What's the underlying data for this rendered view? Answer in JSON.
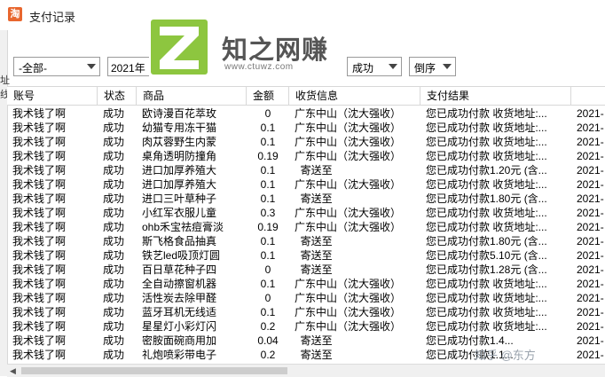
{
  "window": {
    "title": "支付记录",
    "app_icon_label": "淘"
  },
  "left_edge_glyphs": [
    "址",
    "线"
  ],
  "toolbar": {
    "scope_filter": "-全部-",
    "date_value": "2021年",
    "status_filter": "成功",
    "sort_order": "倒序"
  },
  "columns": [
    "账号",
    "状态",
    "商品",
    "金额",
    "收货信息",
    "支付结果"
  ],
  "rows": [
    {
      "account": "我术钱了啊",
      "status": "成功",
      "product": "欧诗漫百花萃玫",
      "amount": "0",
      "address": "广东中山（沈大强收）",
      "result": "您已成功付款 收货地址:...",
      "date": "2021-"
    },
    {
      "account": "我术钱了啊",
      "status": "成功",
      "product": "幼猫专用冻干猫",
      "amount": "0.1",
      "address": "广东中山（沈大强收）",
      "result": "您已成功付款 收货地址:...",
      "date": "2021-"
    },
    {
      "account": "我术钱了啊",
      "status": "成功",
      "product": "肉苁蓉野生内蒙",
      "amount": "0.1",
      "address": "广东中山（沈大强收）",
      "result": "您已成功付款 收货地址:...",
      "date": "2021-"
    },
    {
      "account": "我术钱了啊",
      "status": "成功",
      "product": "桌角透明防撞角",
      "amount": "0.19",
      "address": "广东中山（沈大强收）",
      "result": "您已成功付款 收货地址:...",
      "date": "2021-"
    },
    {
      "account": "我术钱了啊",
      "status": "成功",
      "product": "进口加厚养殖大",
      "amount": "0.1",
      "address": "  寄送至",
      "result": "您已成功付款1.20元 (含...",
      "date": "2021-"
    },
    {
      "account": "我术钱了啊",
      "status": "成功",
      "product": "进口加厚养殖大",
      "amount": "0.1",
      "address": "广东中山（沈大强收）",
      "result": "您已成功付款 收货地址:...",
      "date": "2021-"
    },
    {
      "account": "我术钱了啊",
      "status": "成功",
      "product": "进口三叶草种子",
      "amount": "0.1",
      "address": "  寄送至",
      "result": "您已成功付款1.80元 (含...",
      "date": "2021-"
    },
    {
      "account": "我术钱了啊",
      "status": "成功",
      "product": "小红军衣服儿童",
      "amount": "0.3",
      "address": "广东中山（沈大强收）",
      "result": "您已成功付款 收货地址:...",
      "date": "2021-"
    },
    {
      "account": "我术钱了啊",
      "status": "成功",
      "product": "ohb禾宝祛痘膏淡",
      "amount": "0.19",
      "address": "广东中山（沈大强收）",
      "result": "您已成功付款 收货地址:...",
      "date": "2021-"
    },
    {
      "account": "我术钱了啊",
      "status": "成功",
      "product": "斯飞格食品抽真",
      "amount": "0.1",
      "address": "  寄送至",
      "result": "您已成功付款1.80元 (含...",
      "date": "2021-"
    },
    {
      "account": "我术钱了啊",
      "status": "成功",
      "product": "铁艺led吸顶灯圆",
      "amount": "0.1",
      "address": "  寄送至",
      "result": "您已成功付款5.10元 (含...",
      "date": "2021-"
    },
    {
      "account": "我术钱了啊",
      "status": "成功",
      "product": "百日草花种子四",
      "amount": "0",
      "address": "  寄送至",
      "result": "您已成功付款1.28元 (含...",
      "date": "2021-"
    },
    {
      "account": "我术钱了啊",
      "status": "成功",
      "product": "全自动擦窗机器",
      "amount": "0.1",
      "address": "广东中山（沈大强收）",
      "result": "您已成功付款 收货地址:...",
      "date": "2021-"
    },
    {
      "account": "我术钱了啊",
      "status": "成功",
      "product": "活性炭去除甲醛",
      "amount": "0",
      "address": "广东中山（沈大强收）",
      "result": "您已成功付款 收货地址:...",
      "date": "2021-"
    },
    {
      "account": "我术钱了啊",
      "status": "成功",
      "product": "蓝牙耳机无线适",
      "amount": "0.1",
      "address": "广东中山（沈大强收）",
      "result": "您已成功付款 收货地址:...",
      "date": "2021-"
    },
    {
      "account": "我术钱了啊",
      "status": "成功",
      "product": "星星灯小彩灯闪",
      "amount": "0.2",
      "address": "广东中山（沈大强收）",
      "result": "您已成功付款 收货地址:...",
      "date": "2021-"
    },
    {
      "account": "我术钱了啊",
      "status": "成功",
      "product": "密胺面碗商用加",
      "amount": "0.04",
      "address": "  寄送至",
      "result": "您已成功付款1.4...",
      "date": "2021-"
    },
    {
      "account": "我术钱了啊",
      "status": "成功",
      "product": "礼炮喷彩带电子",
      "amount": "0.2",
      "address": "  寄送至",
      "result": "您已成功付款1.1...",
      "date": "2021-"
    }
  ],
  "watermark": {
    "site_cn": "知之网赚",
    "site_url": "www.ctuwz.com",
    "zhihu_tag": "知乎 @东方",
    "logo_color": "#8dc63f"
  }
}
